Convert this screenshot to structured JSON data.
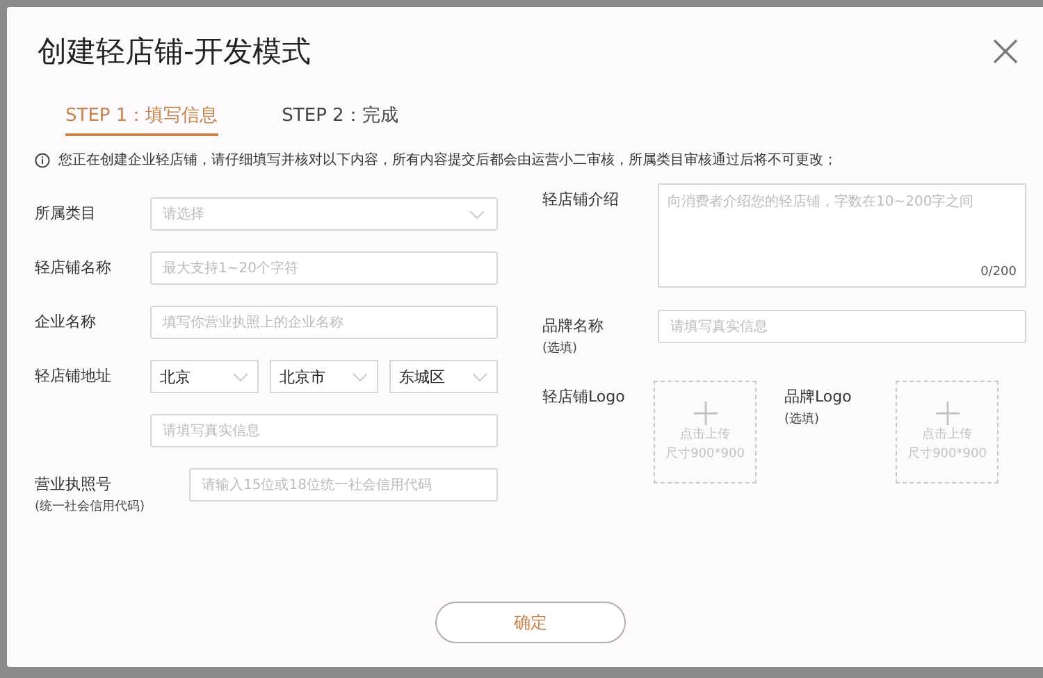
{
  "dialog": {
    "title": "创建轻店铺-开发模式"
  },
  "steps": [
    {
      "label": "STEP 1：填写信息",
      "selected": true
    },
    {
      "label": "STEP 2：完成",
      "selected": false
    }
  ],
  "notice": "您正在创建企业轻店铺，请仔细填写并核对以下内容，所有内容提交后都会由运营小二审核，所属类目审核通过后将不可更改；",
  "left_fields": [
    {
      "kind": "select",
      "label": "所属类目",
      "placeholder": "请选择"
    },
    {
      "kind": "input",
      "label": "轻店铺名称",
      "placeholder": "最大支持1~20个字符"
    },
    {
      "kind": "input",
      "label": "企业名称",
      "placeholder": "填写你营业执照上的企业名称"
    },
    {
      "kind": "address",
      "label": "轻店铺地址",
      "values": [
        "北京",
        "北京市",
        "东城区"
      ]
    },
    {
      "kind": "input",
      "placeholder": "请填写真实信息"
    },
    {
      "kind": "input",
      "label": "营业执照号",
      "sublabel": "(统一社会信用代码)",
      "placeholder": "请输入15位或18位统一社会信用代码"
    }
  ],
  "intro": {
    "label": "轻店铺介绍",
    "placeholder": "向消费者介绍您的轻店铺，字数在10~200字之间",
    "counter": "0/200"
  },
  "brand": {
    "label": "品牌名称",
    "sublabel": "(选填)",
    "placeholder": "请填写真实信息"
  },
  "uploads": [
    {
      "label": "轻店铺Logo",
      "lines": [
        "点击上传",
        "尺寸900*900"
      ]
    },
    {
      "label": "品牌Logo",
      "sublabel": "(选填)",
      "lines": [
        "点击上传",
        "尺寸900*900"
      ]
    }
  ],
  "confirm_button": "确定"
}
